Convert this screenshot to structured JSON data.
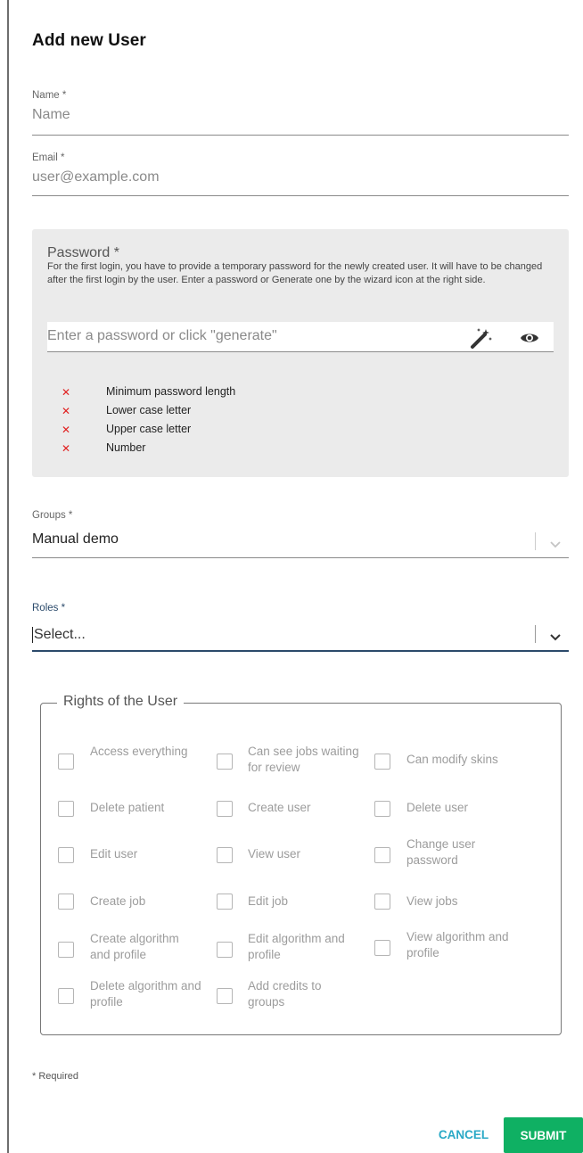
{
  "dialog": {
    "title": "Add new User"
  },
  "name_field": {
    "label": "Name *",
    "placeholder": "Name"
  },
  "email_field": {
    "label": "Email *",
    "placeholder": "user@example.com"
  },
  "password": {
    "title": "Password *",
    "description": "For the first login, you have to provide a temporary password for the newly created user. It will have to be changed after the first login by the user. Enter a password or Generate one by the wizard icon at the right side.",
    "placeholder": "Enter a password or click \"generate\"",
    "generate_icon": "magic-wand-icon",
    "visibility_icon": "eye-icon",
    "requirements": [
      {
        "icon": "x-icon",
        "label": "Minimum password length",
        "met": false
      },
      {
        "icon": "x-icon",
        "label": "Lower case letter",
        "met": false
      },
      {
        "icon": "x-icon",
        "label": "Upper case letter",
        "met": false
      },
      {
        "icon": "x-icon",
        "label": "Number",
        "met": false
      }
    ]
  },
  "groups": {
    "label": "Groups *",
    "value": "Manual demo"
  },
  "roles": {
    "label": "Roles *",
    "placeholder": "Select..."
  },
  "rights": {
    "legend": "Rights of the User",
    "items": [
      {
        "label": "Access everything",
        "checked": false
      },
      {
        "label": "Can see jobs waiting for review",
        "checked": false
      },
      {
        "label": "Can modify skins",
        "checked": false
      },
      {
        "label": "Delete patient",
        "checked": false
      },
      {
        "label": "Create user",
        "checked": false
      },
      {
        "label": "Delete user",
        "checked": false
      },
      {
        "label": "Edit user",
        "checked": false
      },
      {
        "label": "View user",
        "checked": false
      },
      {
        "label": "Change user password",
        "checked": false
      },
      {
        "label": "Create job",
        "checked": false
      },
      {
        "label": "Edit job",
        "checked": false
      },
      {
        "label": "View jobs",
        "checked": false
      },
      {
        "label": "Create algorithm and profile",
        "checked": false
      },
      {
        "label": "Edit algorithm and profile",
        "checked": false
      },
      {
        "label": "View algorithm and profile",
        "checked": false
      },
      {
        "label": "Delete algorithm and profile",
        "checked": false
      },
      {
        "label": "Add credits to groups",
        "checked": false
      }
    ]
  },
  "footer": {
    "required_note": "* Required",
    "cancel_label": "CANCEL",
    "submit_label": "SUBMIT"
  },
  "colors": {
    "submit_bg": "#0fb063",
    "cancel_text": "#2aa9c6",
    "requirement_x": "#e02020",
    "roles_focus": "#2b4a6b"
  }
}
